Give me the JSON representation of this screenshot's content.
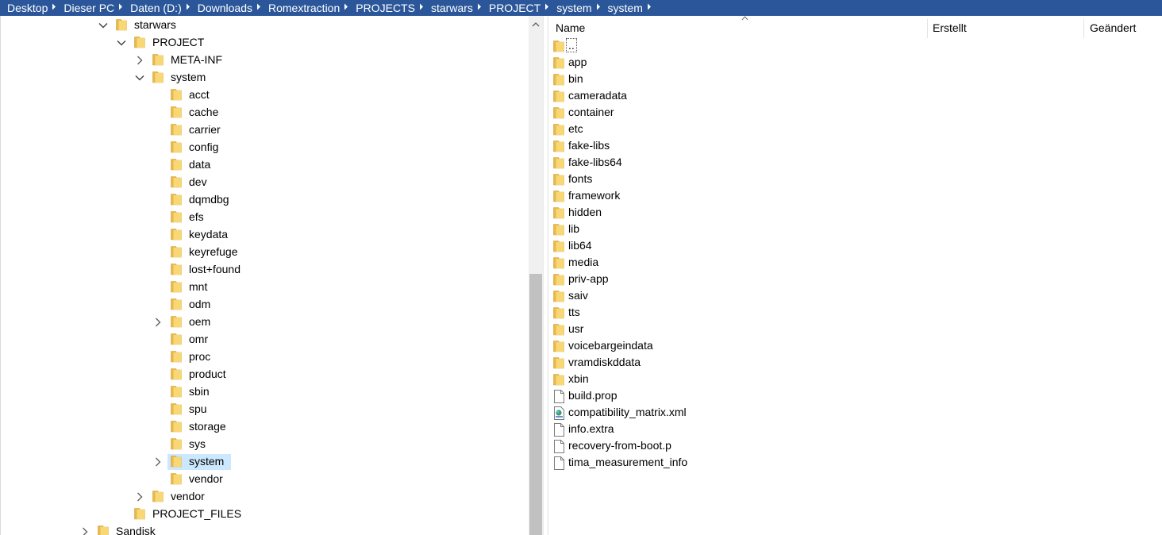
{
  "breadcrumb": [
    "Desktop",
    "Dieser PC",
    "Daten (D:)",
    "Downloads",
    "Romextraction",
    "PROJECTS",
    "starwars",
    "PROJECT",
    "system",
    "system"
  ],
  "tree": [
    {
      "label": "starwars",
      "level": 0,
      "state": "expanded"
    },
    {
      "label": "PROJECT",
      "level": 1,
      "state": "expanded"
    },
    {
      "label": "META-INF",
      "level": 2,
      "state": "collapsed"
    },
    {
      "label": "system",
      "level": 2,
      "state": "expanded"
    },
    {
      "label": "acct",
      "level": 3,
      "state": "none"
    },
    {
      "label": "cache",
      "level": 3,
      "state": "none"
    },
    {
      "label": "carrier",
      "level": 3,
      "state": "none"
    },
    {
      "label": "config",
      "level": 3,
      "state": "none"
    },
    {
      "label": "data",
      "level": 3,
      "state": "none"
    },
    {
      "label": "dev",
      "level": 3,
      "state": "none"
    },
    {
      "label": "dqmdbg",
      "level": 3,
      "state": "none"
    },
    {
      "label": "efs",
      "level": 3,
      "state": "none"
    },
    {
      "label": "keydata",
      "level": 3,
      "state": "none"
    },
    {
      "label": "keyrefuge",
      "level": 3,
      "state": "none"
    },
    {
      "label": "lost+found",
      "level": 3,
      "state": "none"
    },
    {
      "label": "mnt",
      "level": 3,
      "state": "none"
    },
    {
      "label": "odm",
      "level": 3,
      "state": "none"
    },
    {
      "label": "oem",
      "level": 3,
      "state": "collapsed"
    },
    {
      "label": "omr",
      "level": 3,
      "state": "none"
    },
    {
      "label": "proc",
      "level": 3,
      "state": "none"
    },
    {
      "label": "product",
      "level": 3,
      "state": "none"
    },
    {
      "label": "sbin",
      "level": 3,
      "state": "none"
    },
    {
      "label": "spu",
      "level": 3,
      "state": "none"
    },
    {
      "label": "storage",
      "level": 3,
      "state": "none"
    },
    {
      "label": "sys",
      "level": 3,
      "state": "none"
    },
    {
      "label": "system",
      "level": 3,
      "state": "collapsed",
      "selected": true
    },
    {
      "label": "vendor",
      "level": 3,
      "state": "none"
    },
    {
      "label": "vendor",
      "level": 2,
      "state": "collapsed"
    },
    {
      "label": "PROJECT_FILES",
      "level": 1,
      "state": "none"
    },
    {
      "label": "Sandisk",
      "level": -1,
      "state": "collapsed"
    }
  ],
  "columns": {
    "name": "Name",
    "created": "Erstellt",
    "modified": "Geändert"
  },
  "files": [
    {
      "label": "..",
      "type": "folder"
    },
    {
      "label": "app",
      "type": "folder"
    },
    {
      "label": "bin",
      "type": "folder"
    },
    {
      "label": "cameradata",
      "type": "folder"
    },
    {
      "label": "container",
      "type": "folder"
    },
    {
      "label": "etc",
      "type": "folder"
    },
    {
      "label": "fake-libs",
      "type": "folder"
    },
    {
      "label": "fake-libs64",
      "type": "folder"
    },
    {
      "label": "fonts",
      "type": "folder"
    },
    {
      "label": "framework",
      "type": "folder"
    },
    {
      "label": "hidden",
      "type": "folder"
    },
    {
      "label": "lib",
      "type": "folder"
    },
    {
      "label": "lib64",
      "type": "folder"
    },
    {
      "label": "media",
      "type": "folder"
    },
    {
      "label": "priv-app",
      "type": "folder"
    },
    {
      "label": "saiv",
      "type": "folder"
    },
    {
      "label": "tts",
      "type": "folder"
    },
    {
      "label": "usr",
      "type": "folder"
    },
    {
      "label": "voicebargeindata",
      "type": "folder"
    },
    {
      "label": "vramdiskddata",
      "type": "folder"
    },
    {
      "label": "xbin",
      "type": "folder"
    },
    {
      "label": "build.prop",
      "type": "file"
    },
    {
      "label": "compatibility_matrix.xml",
      "type": "xml"
    },
    {
      "label": "info.extra",
      "type": "file"
    },
    {
      "label": "recovery-from-boot.p",
      "type": "file"
    },
    {
      "label": "tima_measurement_info",
      "type": "file"
    }
  ],
  "colors": {
    "accent": "#2b579a",
    "selection": "#cce8ff",
    "folder": "#f8d775"
  }
}
